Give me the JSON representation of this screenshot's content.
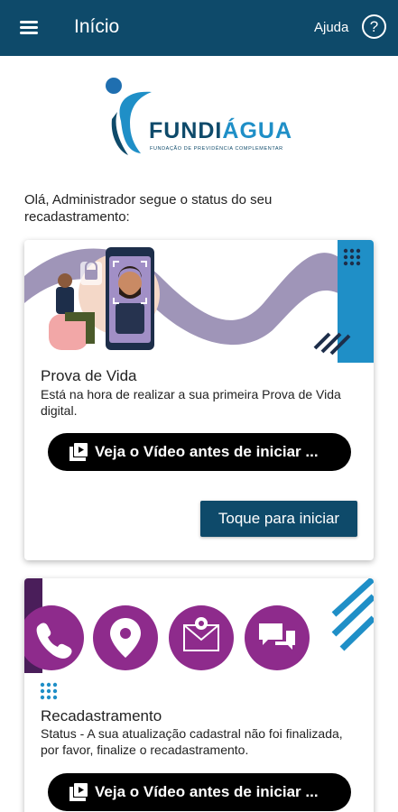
{
  "appbar": {
    "title": "Início",
    "help_label": "Ajuda",
    "help_symbol": "?"
  },
  "logo": {
    "name_main": "FUNDI",
    "name_accent": "ÁGUA",
    "subtitle": "FUNDAÇÃO DE PREVIDÊNCIA COMPLEMENTAR"
  },
  "greeting": "Olá, Administrador segue o status do seu recadastramento:",
  "cards": [
    {
      "title": "Prova de Vida",
      "text": "Está na hora de realizar a sua primeira Prova de Vida digital.",
      "video_button": "Veja o Vídeo antes de iniciar ...",
      "action_button": "Toque para iniciar"
    },
    {
      "title": "Recadastramento",
      "text": "Status - A sua atualização cadastral não foi finalizada, por favor, finalize o recadastramento.",
      "video_button": "Veja o Vídeo antes de iniciar ..."
    }
  ],
  "colors": {
    "primary": "#0e4a6a",
    "accent_blue": "#1f8fc7",
    "purple": "#8e2b8c",
    "lavender": "#9f95b8"
  }
}
